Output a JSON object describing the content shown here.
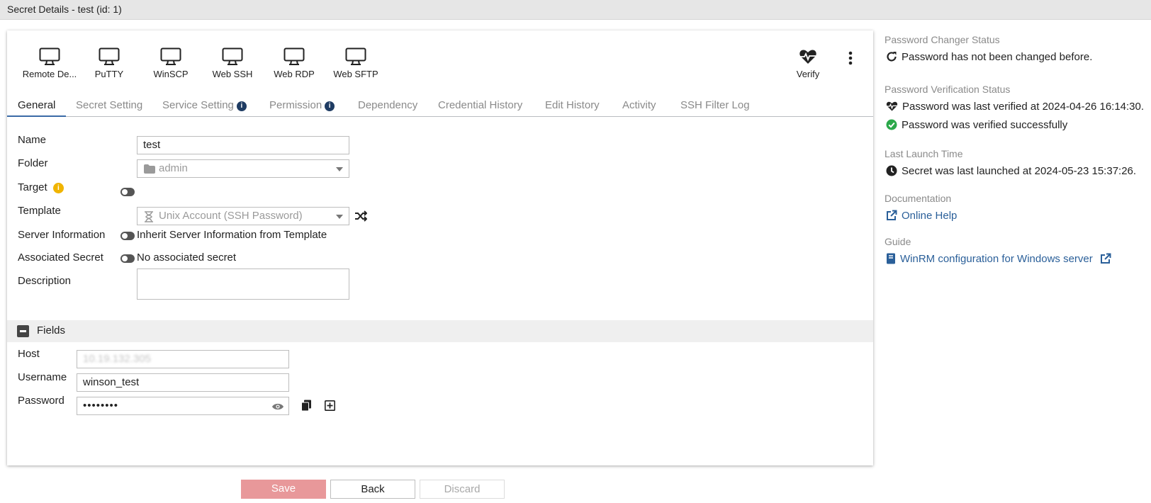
{
  "window": {
    "title": "Secret Details - test (id: 1)"
  },
  "toolbar": {
    "launchers": [
      {
        "label": "Remote De...",
        "icon": "monitor-icon"
      },
      {
        "label": "PuTTY",
        "icon": "monitor-icon"
      },
      {
        "label": "WinSCP",
        "icon": "monitor-icon"
      },
      {
        "label": "Web SSH",
        "icon": "monitor-icon"
      },
      {
        "label": "Web RDP",
        "icon": "monitor-icon"
      },
      {
        "label": "Web SFTP",
        "icon": "monitor-icon"
      }
    ],
    "verify_label": "Verify",
    "more_icon": "vertical-ellipsis-icon"
  },
  "tabs": [
    {
      "label": "General",
      "active": true
    },
    {
      "label": "Secret Setting"
    },
    {
      "label": "Service Setting",
      "info": true
    },
    {
      "label": "Permission",
      "info": true
    },
    {
      "label": "Dependency"
    },
    {
      "label": "Credential History"
    },
    {
      "label": "Edit History"
    },
    {
      "label": "Activity"
    },
    {
      "label": "SSH Filter Log"
    }
  ],
  "general": {
    "name_label": "Name",
    "name_value": "test",
    "folder_label": "Folder",
    "folder_value": "admin",
    "target_label": "Target",
    "template_label": "Template",
    "template_value": "Unix Account (SSH Password)",
    "server_info_label": "Server Information",
    "server_info_value": "Inherit Server Information from Template",
    "associated_label": "Associated Secret",
    "associated_value": "No associated secret",
    "description_label": "Description",
    "description_value": ""
  },
  "fields": {
    "section_title": "Fields",
    "host_label": "Host",
    "host_value": "10.19.132.305",
    "username_label": "Username",
    "username_value": "winson_test",
    "password_label": "Password",
    "password_value": "••••••••"
  },
  "footer": {
    "save_label": "Save",
    "back_label": "Back",
    "discard_label": "Discard"
  },
  "sidebar": {
    "changer_heading": "Password Changer Status",
    "changer_text": "Password has not been changed before.",
    "verification_heading": "Password Verification Status",
    "verification_text": "Password was last verified at 2024-04-26 16:14:30.",
    "verification_result": "Password was verified successfully",
    "launch_heading": "Last Launch Time",
    "launch_text": "Secret was last launched at 2024-05-23 15:37:26.",
    "documentation_heading": "Documentation",
    "documentation_link": "Online Help",
    "guide_heading": "Guide",
    "guide_link": "WinRM configuration for Windows server"
  },
  "colors": {
    "accent": "#3a6aa6",
    "link": "#2a5f99",
    "save": "#e8989a",
    "success": "#2ba84a",
    "info_warning": "#f0b400"
  }
}
